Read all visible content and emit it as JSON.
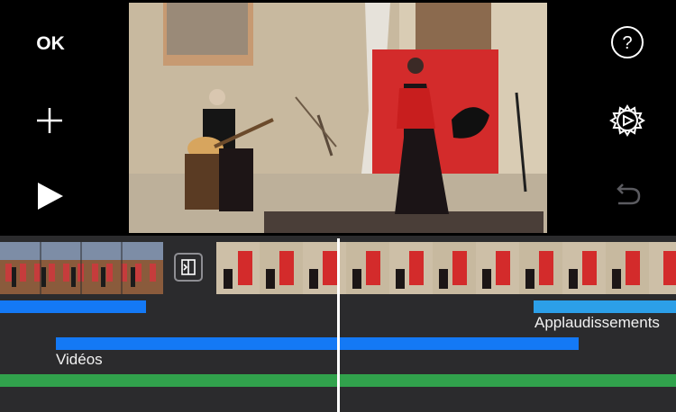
{
  "toolbar": {
    "ok_label": "OK",
    "add_icon": "plus-icon",
    "play_icon": "play-icon",
    "help_icon": "question-circle-icon",
    "settings_icon": "gear-icon",
    "undo_icon": "undo-icon"
  },
  "viewer": {
    "content": "video-preview"
  },
  "timeline": {
    "transition_icon": "transition-icon",
    "audio_tracks": [
      {
        "label": "Applaudissements"
      },
      {
        "label": "Vidéos"
      }
    ]
  },
  "colors": {
    "background": "#000000",
    "timeline": "#2b2b2d",
    "audio_blue": "#1479f5",
    "audio_light_blue": "#2c9fe8",
    "audio_green": "#31a24c",
    "playhead": "#ffffff"
  }
}
